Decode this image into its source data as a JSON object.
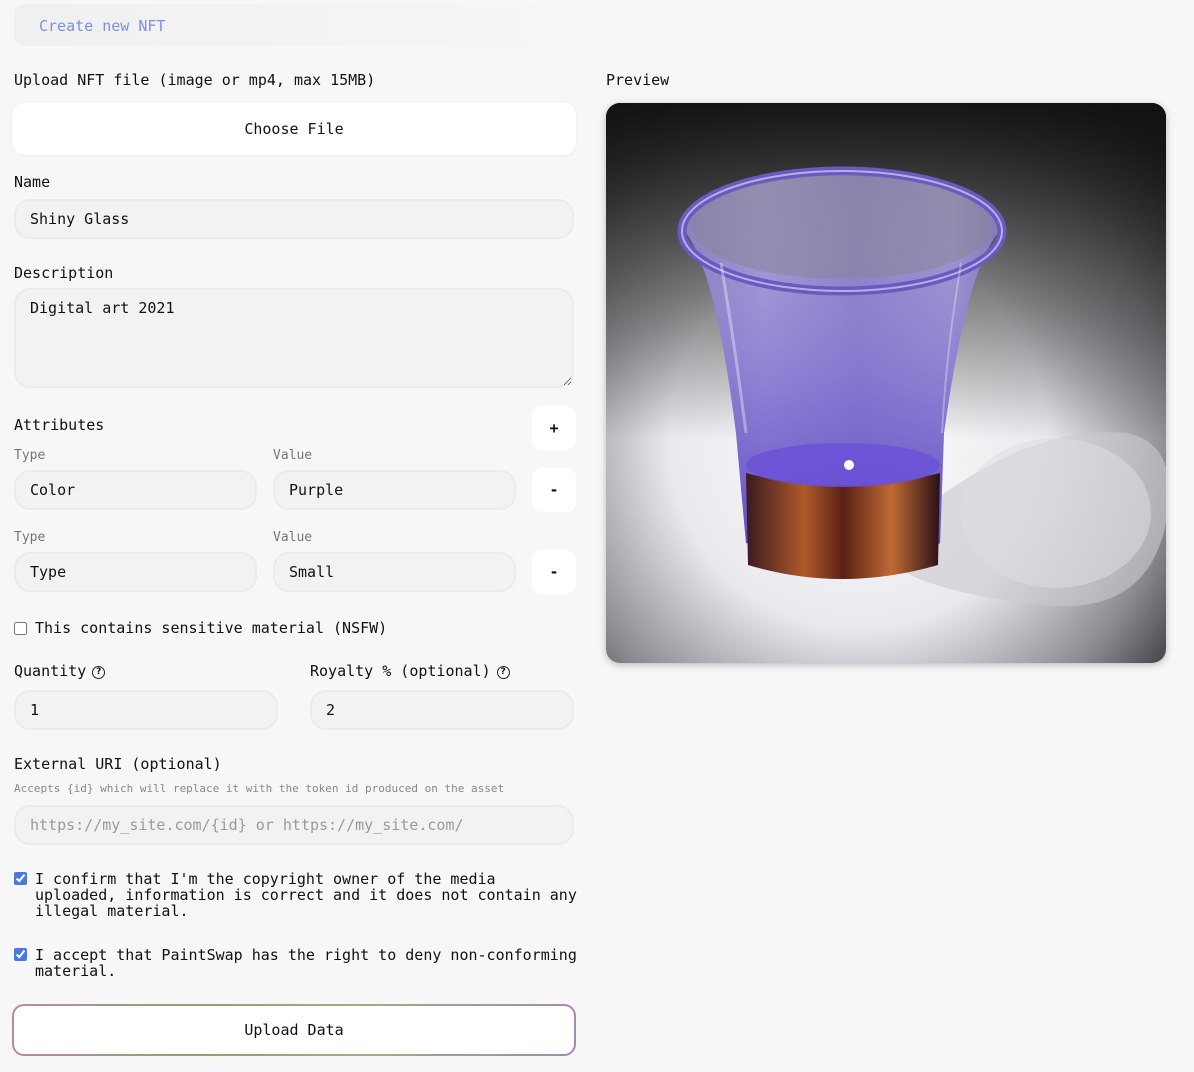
{
  "header": {
    "title": "Create new NFT"
  },
  "upload": {
    "label": "Upload NFT file (image or mp4, max 15MB)",
    "choose_file_label": "Choose File"
  },
  "name": {
    "label": "Name",
    "value": "Shiny Glass"
  },
  "description": {
    "label": "Description",
    "value": "Digital art 2021"
  },
  "attributes": {
    "label": "Attributes",
    "add_label": "+",
    "remove_label": "-",
    "type_label": "Type",
    "value_label": "Value",
    "rows": [
      {
        "type": "Color",
        "value": "Purple"
      },
      {
        "type": "Type",
        "value": "Small"
      }
    ]
  },
  "nsfw": {
    "label": "This contains sensitive material (NSFW)",
    "checked": false
  },
  "quantity": {
    "label": "Quantity",
    "value": "1"
  },
  "royalty": {
    "label": "Royalty % (optional)",
    "value": "2"
  },
  "external_uri": {
    "label": "External URI (optional)",
    "hint": "Accepts {id} which will replace it with the token id produced on the asset",
    "placeholder": "https://my_site.com/{id} or https://my_site.com/",
    "value": ""
  },
  "confirm_copyright": {
    "label": "I confirm that I'm the copyright owner of the media uploaded, information is correct and it does not contain any illegal material.",
    "checked": true
  },
  "accept_terms": {
    "label": "I accept that PaintSwap has the right to deny non-conforming material.",
    "checked": true
  },
  "upload_button_label": "Upload Data",
  "preview": {
    "label": "Preview"
  },
  "icons": {
    "help": "question-circle-icon"
  },
  "colors": {
    "accent": "#7b8fe6",
    "checkbox": "#4a78e0"
  }
}
